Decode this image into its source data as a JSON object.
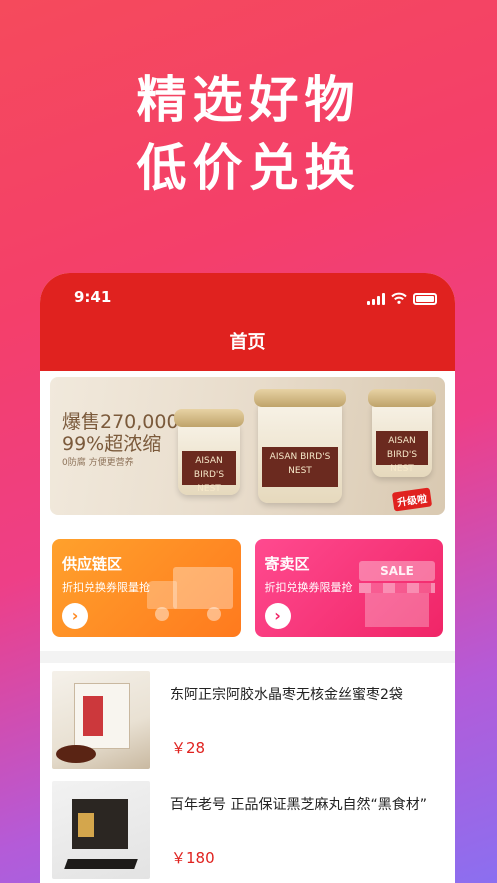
{
  "hero": {
    "line1": "精选好物",
    "line2": "低价兑换"
  },
  "status_bar": {
    "time": "9:41"
  },
  "nav": {
    "title": "首页"
  },
  "banner": {
    "headline1": "爆售270,000瓶",
    "headline2": "99%超浓缩",
    "tagline": "0防腐 方便更营养",
    "jar_label": "AISAN BIRD'S NEST",
    "badge": "升级啦"
  },
  "zones": [
    {
      "title": "供应链区",
      "subtitle": "折扣兑换券限量抢",
      "icon": "truck-icon"
    },
    {
      "title": "寄卖区",
      "subtitle": "折扣兑换券限量抢",
      "icon": "shop-icon",
      "shop_sign": "SALE"
    }
  ],
  "products": [
    {
      "title": "东阿正宗阿胶水晶枣无核金丝蜜枣2袋",
      "price": "￥28"
    },
    {
      "title": "百年老号 正品保证黑芝麻丸自然“黑食材”",
      "price": "￥180"
    }
  ],
  "colors": {
    "primary_red": "#e0221f",
    "orange_zone": "#ff8a22",
    "pink_zone": "#f02567"
  }
}
